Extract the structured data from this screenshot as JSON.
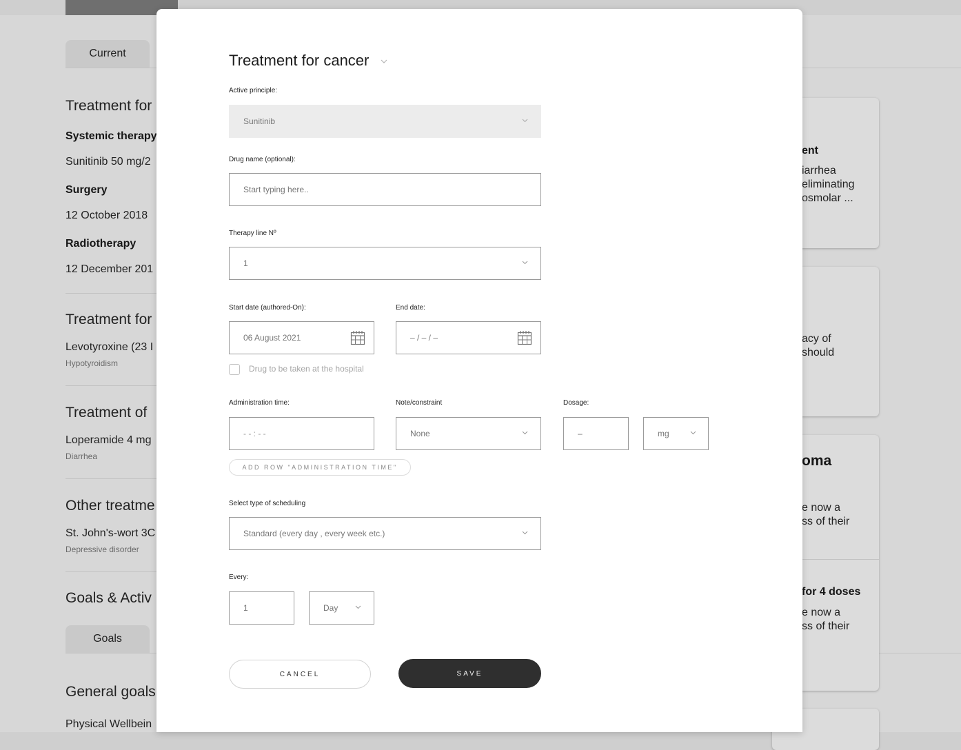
{
  "background": {
    "tabs": {
      "current": "Current",
      "goals": "Goals"
    },
    "sections": {
      "treatment_1": "Treatment for",
      "systemic_therapy": "Systemic therapy",
      "sunitinib": "Sunitinib 50 mg/2",
      "surgery": "Surgery",
      "surgery_date": "12 October 2018",
      "radiotherapy": "Radiotherapy",
      "radiotherapy_date": "12 December 201",
      "treatment_2": "Treatment for",
      "levothyroxine": "Levotyroxine (23 I",
      "hypothyroidism": "Hypotyroidism",
      "treatment_3": "Treatment of",
      "loperamide": "Loperamide 4 mg",
      "diarrhea": "Diarrhea",
      "other_treatments": "Other treatme",
      "st_johns_wort": "St. John's-wort 3C",
      "depressive_disorder": "Depressive disorder",
      "goals_activities": "Goals & Activ",
      "general_goals": "General goals",
      "physical_wellbeing": "Physical Wellbein"
    },
    "cards": {
      "c1_title": "ent",
      "c1_l1": "iarrhea",
      "c1_l2": "eliminating",
      "c1_l3": "osmolar ...",
      "c2_l1": "acy of",
      "c2_l2": "should",
      "c3_title": "oma",
      "c3_l1": "e now a",
      "c3_l2": "ss of their",
      "c4_title": "for 4 doses",
      "c4_l1": "e now a",
      "c4_l2": "ss of their"
    }
  },
  "modal": {
    "title": "Treatment for cancer",
    "active_principle": {
      "label": "Active principle:",
      "value": "Sunitinib"
    },
    "drug_name": {
      "label": "Drug name (optional):",
      "placeholder": "Start typing here.."
    },
    "therapy_line": {
      "label": "Therapy line Nº",
      "value": "1"
    },
    "start_date": {
      "label": "Start date (authored-On):",
      "value": "06 August 2021"
    },
    "end_date": {
      "label": "End date:",
      "value": "– / – / –"
    },
    "hospital_checkbox": {
      "label": "Drug to be taken at the hospital",
      "checked": false
    },
    "administration_time": {
      "label": "Administration time:",
      "value": "- - : - -"
    },
    "note_constraint": {
      "label": "Note/constraint",
      "value": "None"
    },
    "dosage": {
      "label": "Dosage:",
      "value": "–",
      "unit": "mg"
    },
    "add_row_button": "ADD ROW \"ADMINISTRATION TIME\"",
    "scheduling": {
      "label": "Select type of scheduling",
      "value": "Standard (every day , every week etc.)"
    },
    "every": {
      "label": "Every:",
      "value": "1",
      "unit": "Day"
    },
    "cancel_button": "CANCEL",
    "save_button": "SAVE"
  },
  "colors": {
    "save_button": "#2f2f2f",
    "field_border": "#9a9a9a",
    "disabled_field": "#ececec",
    "backdrop": "#d7d7d7"
  }
}
